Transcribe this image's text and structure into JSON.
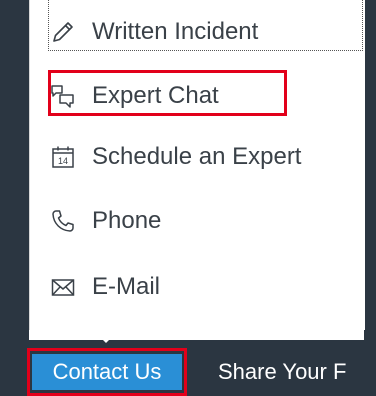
{
  "menu": {
    "items": [
      {
        "label": "Written Incident",
        "icon": "pencil-icon"
      },
      {
        "label": "Expert Chat",
        "icon": "chat-bubbles-icon"
      },
      {
        "label": "Schedule an Expert",
        "icon": "calendar-icon",
        "calendar_day": "14"
      },
      {
        "label": "Phone",
        "icon": "phone-icon"
      },
      {
        "label": "E-Mail",
        "icon": "envelope-icon"
      }
    ]
  },
  "nav": {
    "tabs": [
      {
        "label": "Contact Us",
        "active": true
      },
      {
        "label": "Share Your F"
      }
    ]
  },
  "colors": {
    "nav_background": "#2b3641",
    "active_tab": "#2a8fd6",
    "highlight": "#e2001a",
    "text": "#3a4148"
  }
}
